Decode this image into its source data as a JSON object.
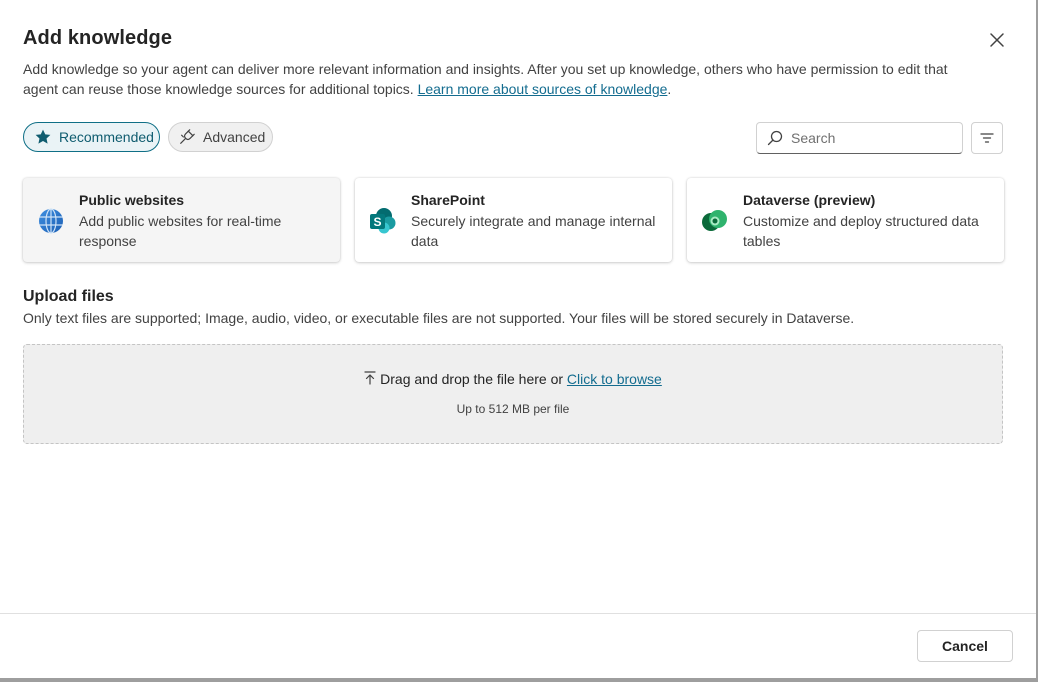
{
  "dialog": {
    "title": "Add knowledge",
    "description": "Add knowledge so your agent can deliver more relevant information and insights. After you set up knowledge, others who have permission to edit that agent can reuse those knowledge sources for additional topics. ",
    "learn_more_link": "Learn more about sources of knowledge",
    "description_end": "."
  },
  "tabs": [
    {
      "label": "Recommended",
      "icon": "star-icon",
      "selected": true
    },
    {
      "label": "Advanced",
      "icon": "plug-icon",
      "selected": false
    }
  ],
  "search": {
    "placeholder": "Search",
    "value": ""
  },
  "cards": [
    {
      "title": "Public websites",
      "subtitle": "Add public websites for real-time response",
      "icon": "globe-icon"
    },
    {
      "title": "SharePoint",
      "subtitle": "Securely integrate and manage internal data",
      "icon": "sharepoint-icon"
    },
    {
      "title": "Dataverse (preview)",
      "subtitle": "Customize and deploy structured data tables",
      "icon": "dataverse-icon"
    }
  ],
  "upload": {
    "title": "Upload files",
    "description": "Only text files are supported; Image, audio, video, or executable files are not supported. Your files will be stored securely in Dataverse.",
    "drop_text": "Drag and drop the file here or ",
    "browse_link": "Click to browse",
    "limit": "Up to 512 MB per file"
  },
  "footer": {
    "cancel_label": "Cancel"
  },
  "colors": {
    "accent": "#0f6f86",
    "link": "#136c8f"
  }
}
